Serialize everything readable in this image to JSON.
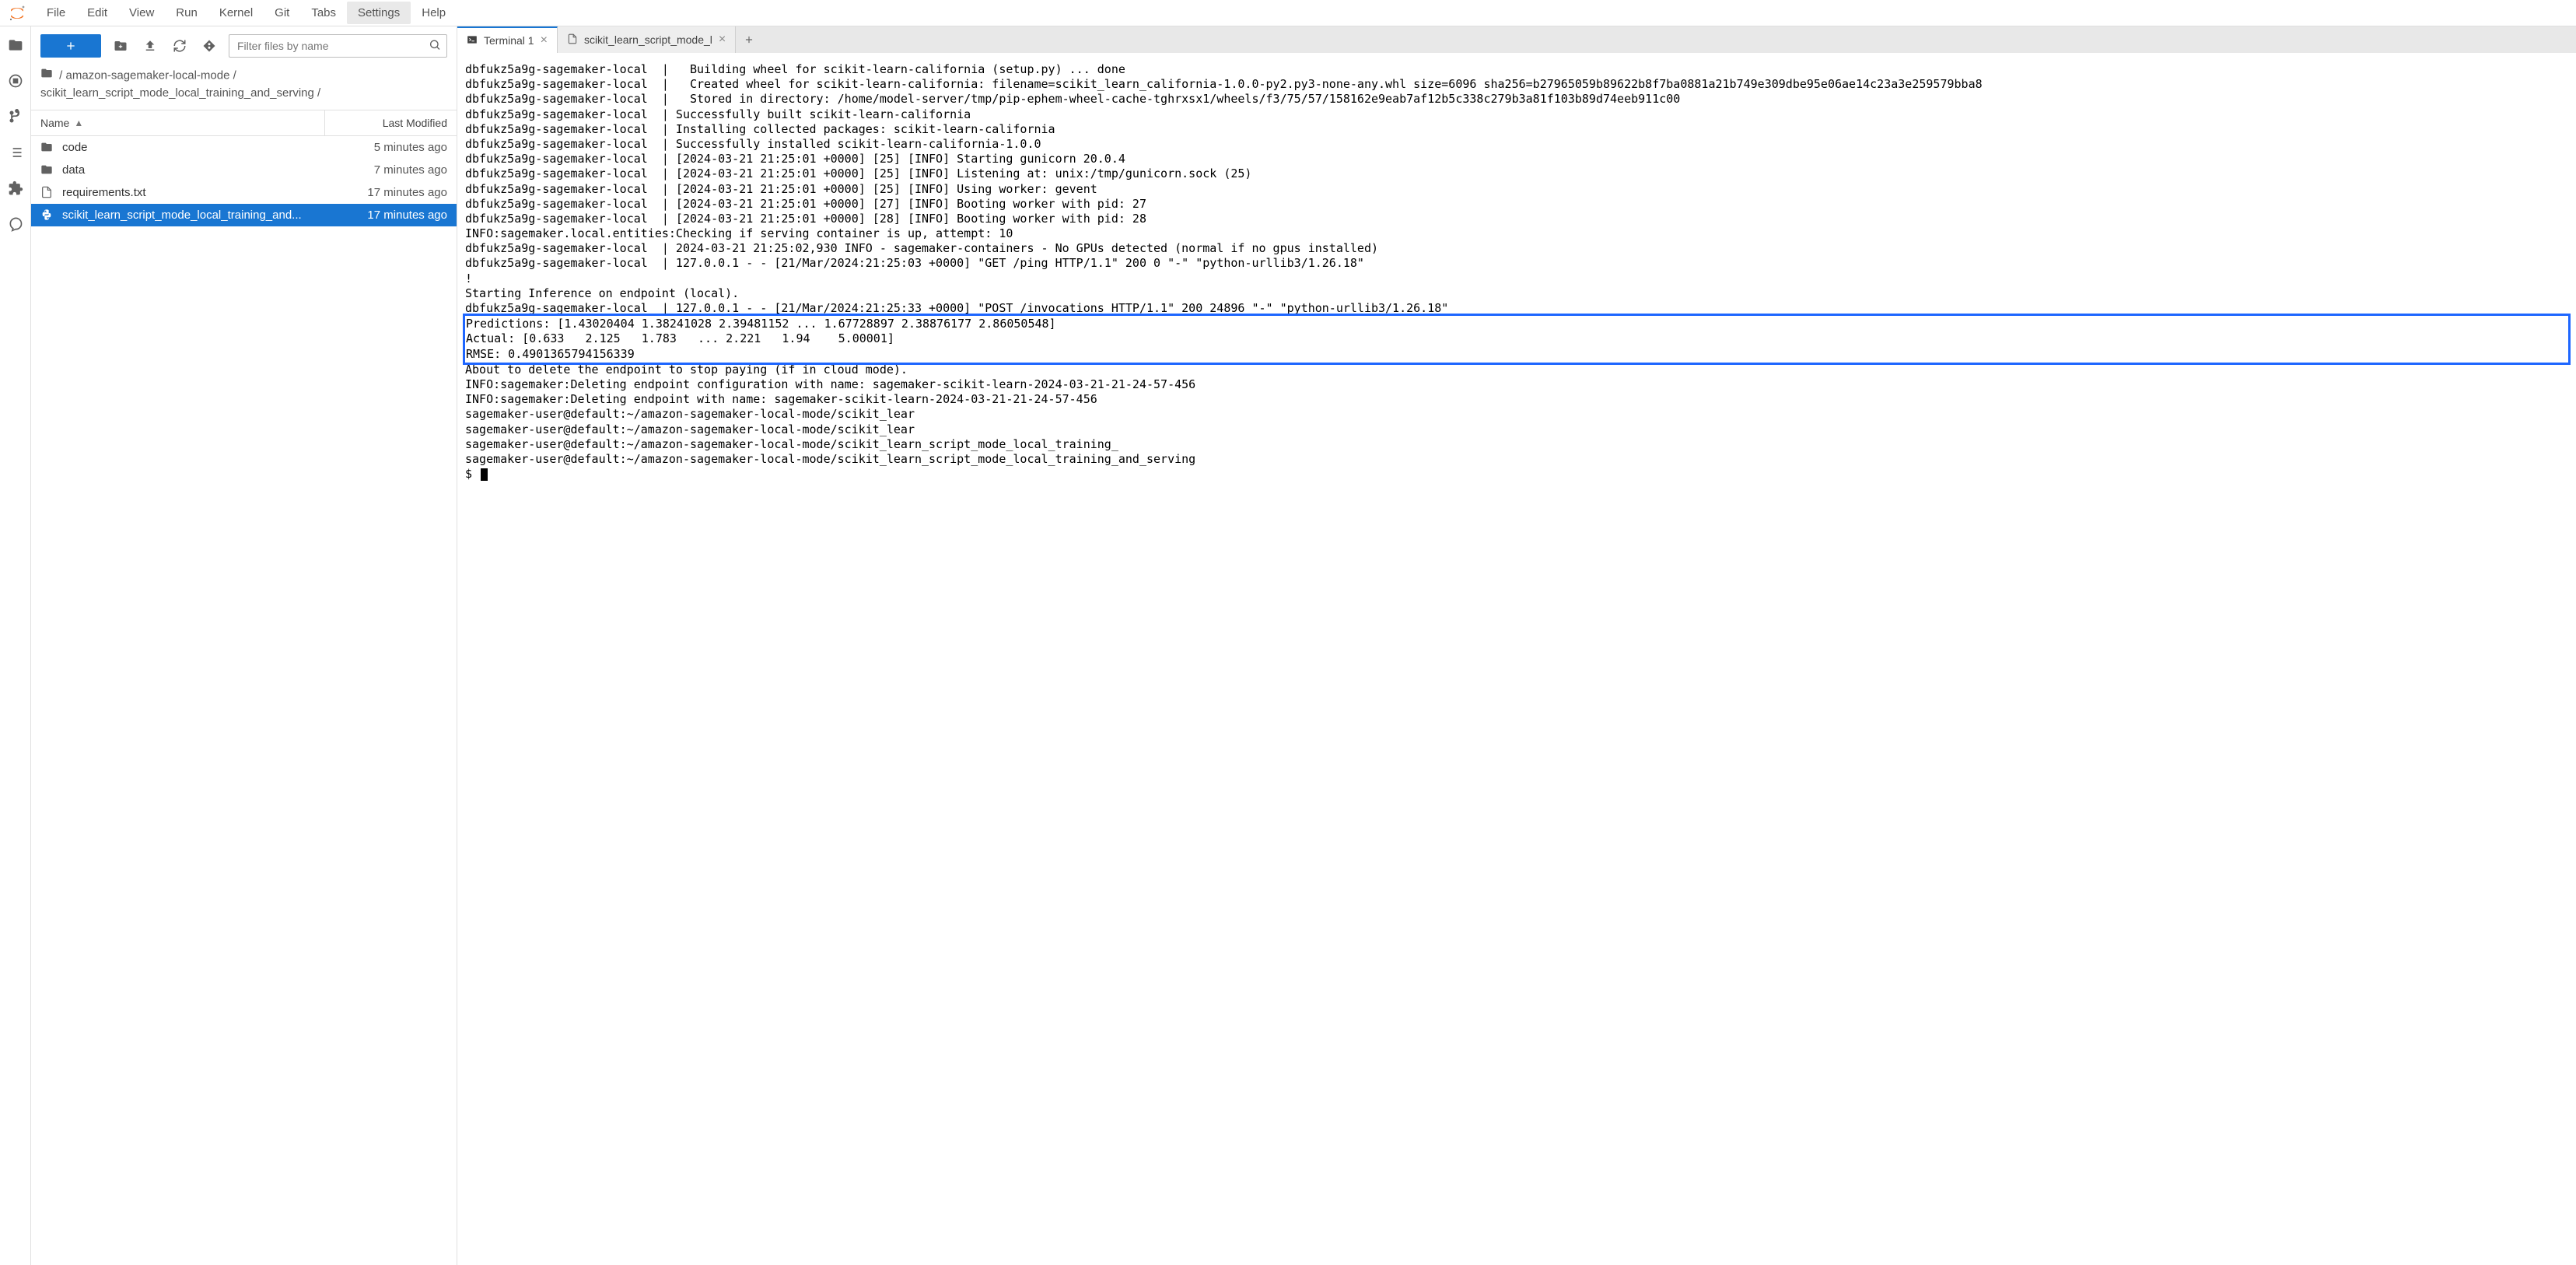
{
  "menu": {
    "items": [
      "File",
      "Edit",
      "View",
      "Run",
      "Kernel",
      "Git",
      "Tabs",
      "Settings",
      "Help"
    ],
    "active_index": 7
  },
  "sidebar_icons": [
    "folder-icon",
    "stop-circle-icon",
    "git-branch-icon",
    "list-icon",
    "extension-icon",
    "comments-icon"
  ],
  "filebrowser": {
    "filter_placeholder": "Filter files by name",
    "breadcrumb": "/ amazon-sagemaker-local-mode / scikit_learn_script_mode_local_training_and_serving /",
    "header": {
      "name": "Name",
      "modified": "Last Modified"
    },
    "rows": [
      {
        "icon": "folder-icon",
        "name": "code",
        "modified": "5 minutes ago",
        "selected": false
      },
      {
        "icon": "folder-icon",
        "name": "data",
        "modified": "7 minutes ago",
        "selected": false
      },
      {
        "icon": "file-icon",
        "name": "requirements.txt",
        "modified": "17 minutes ago",
        "selected": false
      },
      {
        "icon": "python-icon",
        "name": "scikit_learn_script_mode_local_training_and...",
        "modified": "17 minutes ago",
        "selected": true
      }
    ]
  },
  "tabs": [
    {
      "icon": "terminal-icon",
      "label": "Terminal 1",
      "active": true
    },
    {
      "icon": "file-icon",
      "label": "scikit_learn_script_mode_l",
      "active": false
    }
  ],
  "terminal": {
    "pre_lines": "dbfukz5a9g-sagemaker-local  |   Building wheel for scikit-learn-california (setup.py) ... done\ndbfukz5a9g-sagemaker-local  |   Created wheel for scikit-learn-california: filename=scikit_learn_california-1.0.0-py2.py3-none-any.whl size=6096 sha256=b27965059b89622b8f7ba0881a21b749e309dbe95e06ae14c23a3e259579bba8\ndbfukz5a9g-sagemaker-local  |   Stored in directory: /home/model-server/tmp/pip-ephem-wheel-cache-tghrxsx1/wheels/f3/75/57/158162e9eab7af12b5c338c279b3a81f103b89d74eeb911c00\ndbfukz5a9g-sagemaker-local  | Successfully built scikit-learn-california\ndbfukz5a9g-sagemaker-local  | Installing collected packages: scikit-learn-california\ndbfukz5a9g-sagemaker-local  | Successfully installed scikit-learn-california-1.0.0\ndbfukz5a9g-sagemaker-local  | [2024-03-21 21:25:01 +0000] [25] [INFO] Starting gunicorn 20.0.4\ndbfukz5a9g-sagemaker-local  | [2024-03-21 21:25:01 +0000] [25] [INFO] Listening at: unix:/tmp/gunicorn.sock (25)\ndbfukz5a9g-sagemaker-local  | [2024-03-21 21:25:01 +0000] [25] [INFO] Using worker: gevent\ndbfukz5a9g-sagemaker-local  | [2024-03-21 21:25:01 +0000] [27] [INFO] Booting worker with pid: 27\ndbfukz5a9g-sagemaker-local  | [2024-03-21 21:25:01 +0000] [28] [INFO] Booting worker with pid: 28\nINFO:sagemaker.local.entities:Checking if serving container is up, attempt: 10\ndbfukz5a9g-sagemaker-local  | 2024-03-21 21:25:02,930 INFO - sagemaker-containers - No GPUs detected (normal if no gpus installed)\ndbfukz5a9g-sagemaker-local  | 127.0.0.1 - - [21/Mar/2024:21:25:03 +0000] \"GET /ping HTTP/1.1\" 200 0 \"-\" \"python-urllib3/1.26.18\"\n!\nStarting Inference on endpoint (local).\ndbfukz5a9g-sagemaker-local  | 127.0.0.1 - - [21/Mar/2024:21:25:33 +0000] \"POST /invocations HTTP/1.1\" 200 24896 \"-\" \"python-urllib3/1.26.18\"",
    "highlight_lines": "Predictions: [1.43020404 1.38241028 2.39481152 ... 1.67728897 2.38876177 2.86050548]\nActual: [0.633   2.125   1.783   ... 2.221   1.94    5.00001]\nRMSE: 0.4901365794156339",
    "post_lines": "About to delete the endpoint to stop paying (if in cloud mode).\nINFO:sagemaker:Deleting endpoint configuration with name: sagemaker-scikit-learn-2024-03-21-21-24-57-456\nINFO:sagemaker:Deleting endpoint with name: sagemaker-scikit-learn-2024-03-21-21-24-57-456\nsagemaker-user@default:~/amazon-sagemaker-local-mode/scikit_lear\nsagemaker-user@default:~/amazon-sagemaker-local-mode/scikit_lear\nsagemaker-user@default:~/amazon-sagemaker-local-mode/scikit_learn_script_mode_local_training_\nsagemaker-user@default:~/amazon-sagemaker-local-mode/scikit_learn_script_mode_local_training_and_serving\n$ "
  }
}
